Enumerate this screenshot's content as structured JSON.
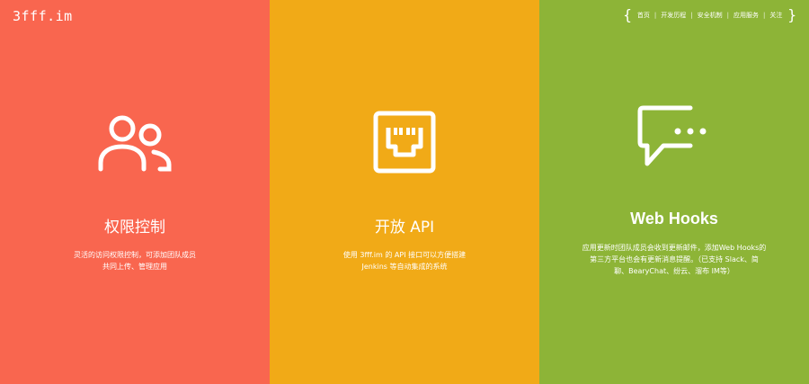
{
  "header": {
    "logo": "3fff.im",
    "nav": [
      "首页",
      "开发历程",
      "安全机制",
      "应用服务",
      "关注"
    ]
  },
  "features": [
    {
      "icon": "users-icon",
      "title": "权限控制",
      "desc_line1": "灵活的访问权限控制，可添加团队成员",
      "desc_line2": "共同上传、管理应用"
    },
    {
      "icon": "ethernet-port-icon",
      "title": "开放 API",
      "desc_line1": "使用 3fff.im 的 API 接口可以方便搭建",
      "desc_line2": "Jenkins 等自动集成的系统"
    },
    {
      "icon": "chat-bubble-icon",
      "title": "Web Hooks",
      "desc_line1": "应用更新时团队成员会收到更新邮件，添加Web Hooks的",
      "desc_line2": "第三方平台也会有更新消息提醒。（已支持 Slack、简",
      "desc_line3": "聊、BearyChat、纷云、溜布 IM等）"
    }
  ],
  "colors": {
    "panel1": "#F9664F",
    "panel2": "#F1AA17",
    "panel3": "#8DB437"
  }
}
